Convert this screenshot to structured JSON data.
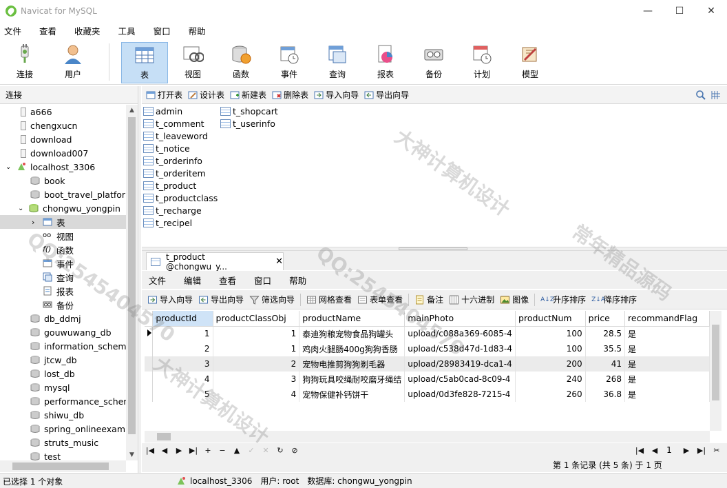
{
  "window": {
    "title": "Navicat for MySQL",
    "minimize": "—",
    "maximize": "☐",
    "close": "✕"
  },
  "menu": [
    "文件",
    "查看",
    "收藏夹",
    "工具",
    "窗口",
    "帮助"
  ],
  "toolbar": {
    "connect": "连接",
    "user": "用户",
    "table": "表",
    "view": "视图",
    "function": "函数",
    "event": "事件",
    "query": "查询",
    "report": "报表",
    "backup": "备份",
    "schedule": "计划",
    "model": "模型"
  },
  "left_panel": {
    "header": "连接",
    "items": [
      {
        "label": "a666"
      },
      {
        "label": "chengxucn"
      },
      {
        "label": "download"
      },
      {
        "label": "download007"
      },
      {
        "label": "localhost_3306"
      },
      {
        "label": "book"
      },
      {
        "label": "boot_travel_platform"
      },
      {
        "label": "chongwu_yongpin"
      },
      {
        "label": "表"
      },
      {
        "label": "视图"
      },
      {
        "label": "函数"
      },
      {
        "label": "事件"
      },
      {
        "label": "查询"
      },
      {
        "label": "报表"
      },
      {
        "label": "备份"
      },
      {
        "label": "db_ddmj"
      },
      {
        "label": "gouwuwang_db"
      },
      {
        "label": "information_schema"
      },
      {
        "label": "jtcw_db"
      },
      {
        "label": "lost_db"
      },
      {
        "label": "mysql"
      },
      {
        "label": "performance_schema"
      },
      {
        "label": "shiwu_db"
      },
      {
        "label": "spring_onlineexam"
      },
      {
        "label": "struts_music"
      },
      {
        "label": "test"
      }
    ]
  },
  "object_toolbar": {
    "open": "打开表",
    "design": "设计表",
    "new": "新建表",
    "delete": "删除表",
    "import": "导入向导",
    "export": "导出向导"
  },
  "tables": [
    "admin",
    "t_comment",
    "t_leaveword",
    "t_notice",
    "t_orderinfo",
    "t_orderitem",
    "t_product",
    "t_productclass",
    "t_recharge",
    "t_recipel",
    "t_shopcart",
    "t_userinfo"
  ],
  "tab": {
    "label": "t_product @chongwu_y...",
    "close": "✕"
  },
  "inner_menu": [
    "文件",
    "编辑",
    "查看",
    "窗口",
    "帮助"
  ],
  "inner_toolbar": {
    "import": "导入向导",
    "export": "导出向导",
    "filter": "筛选向导",
    "grid_view": "网格查看",
    "form_view": "表单查看",
    "memo": "备注",
    "hex": "十六进制",
    "image": "图像",
    "sort_asc": "升序排序",
    "sort_desc": "降序排序"
  },
  "grid": {
    "columns": [
      "productId",
      "productClassObj",
      "productName",
      "mainPhoto",
      "productNum",
      "price",
      "recommandFlag"
    ],
    "rows": [
      [
        "1",
        "1",
        "泰迪狗粮宠物食品狗罐头",
        "upload/c088a369-6085-4",
        "100",
        "28.5",
        "是"
      ],
      [
        "2",
        "1",
        "鸡肉火腿肠400g狗狗香肠",
        "upload/c538d47d-1d83-4",
        "100",
        "35.5",
        "是"
      ],
      [
        "3",
        "2",
        "宠物电推剪狗狗剃毛器",
        "upload/28983419-dca1-4",
        "200",
        "41",
        "是"
      ],
      [
        "4",
        "3",
        "狗狗玩具咬绳耐咬磨牙绳结",
        "upload/c5ab0cad-8c09-4",
        "240",
        "268",
        "是"
      ],
      [
        "5",
        "4",
        "宠物保健补钙饼干",
        "upload/0d3fe828-7215-4",
        "260",
        "36.8",
        "是"
      ]
    ]
  },
  "navigator": {
    "page": "1"
  },
  "record_info": "第 1 条记录 (共 5 条) 于 1 页",
  "status": {
    "selected": "已选择 1 个对象",
    "connection": "localhost_3306",
    "user": "用户: root",
    "database": "数据库: chongwu_yongpin"
  },
  "watermark": {
    "line1": "大神计算机设计",
    "line2": "QQ:2545404570",
    "line3": "常年精品源码"
  }
}
